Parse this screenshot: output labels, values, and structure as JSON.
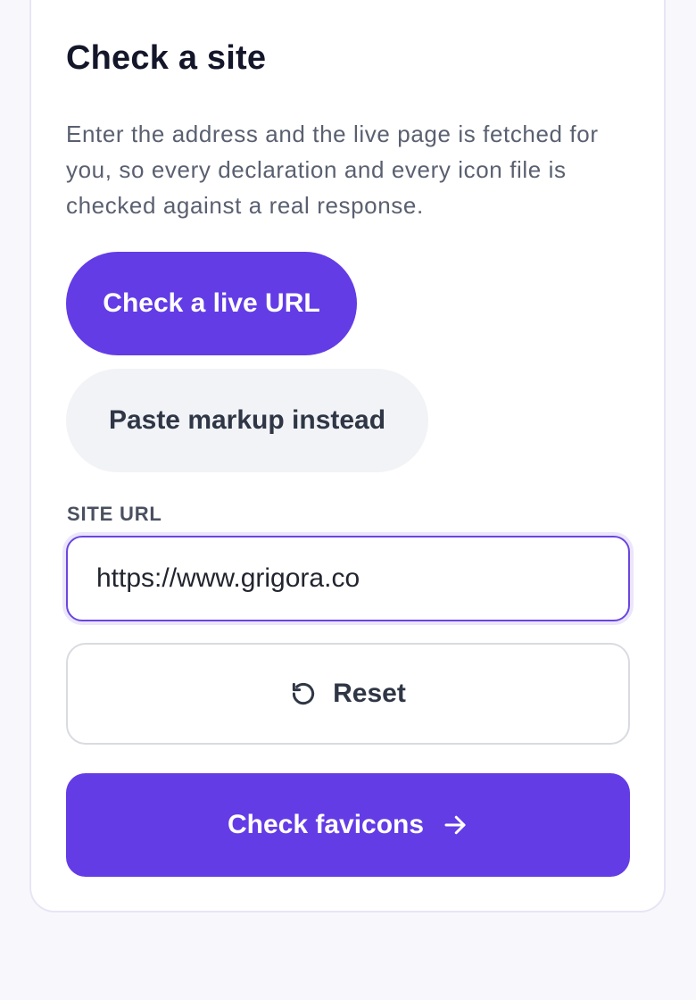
{
  "panel": {
    "title": "Check a site",
    "description": "Enter the address and the live page is fetched for you, so every declaration and every icon file is checked against a real response."
  },
  "mode": {
    "live_label": "Check a live URL",
    "paste_label": "Paste markup instead",
    "selected": "Check a live URL"
  },
  "url_field": {
    "label": "SITE URL",
    "value": "https://www.grigora.co"
  },
  "actions": {
    "reset_label": "Reset",
    "reset_icon": "rotate-ccw-icon",
    "submit_label": "Check favicons",
    "submit_icon": "arrow-right-icon"
  },
  "colors": {
    "accent": "#633ce6",
    "background": "#f8f8fc"
  }
}
